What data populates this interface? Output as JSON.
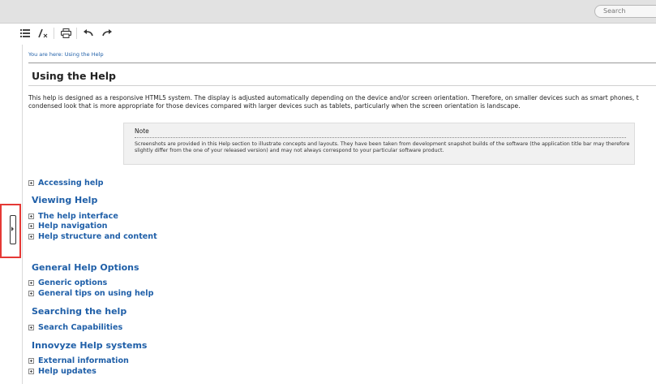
{
  "search": {
    "placeholder": "Search"
  },
  "toolbar": {
    "buttons": [
      {
        "name": "toc-icon"
      },
      {
        "name": "clear-highlight-icon"
      },
      {
        "name": "print-icon"
      },
      {
        "name": "back-icon"
      },
      {
        "name": "forward-icon"
      }
    ]
  },
  "breadcrumb": "You are here: Using the Help",
  "page_title": "Using the Help",
  "intro": [
    "This help is designed as a responsive HTML5 system. The display is adjusted automatically depending on the device and/or screen orientation. Therefore, on smaller devices such as smart phones, t",
    "condensed look that is more appropriate for those devices compared with larger devices such as tablets, particularly when the screen orientation is landscape."
  ],
  "note": {
    "title": "Note",
    "text": "Screenshots are provided in this Help section to illustrate concepts and layouts. They have been taken from development snapshot builds of the software (the application title bar may therefore slightly differ from the one of your released version) and may not always correspond to your particular software product."
  },
  "links": {
    "accessing_help": "Accessing help",
    "help_interface": "The help interface",
    "help_navigation": "Help navigation",
    "help_structure": "Help structure and content",
    "generic_options": "Generic options",
    "general_tips": "General tips on using help",
    "search_capabilities": "Search Capabilities",
    "external_information": "External information",
    "help_updates": "Help updates"
  },
  "sections": {
    "viewing_help": "Viewing Help",
    "general_options": "General Help Options",
    "searching": "Searching the help",
    "innovyze": "Innovyze Help systems"
  },
  "colors": {
    "link": "#1f5fa8",
    "toolbar_bg": "#e2e2e2",
    "note_bg": "#f1f1f1",
    "highlight": "#e53935"
  }
}
